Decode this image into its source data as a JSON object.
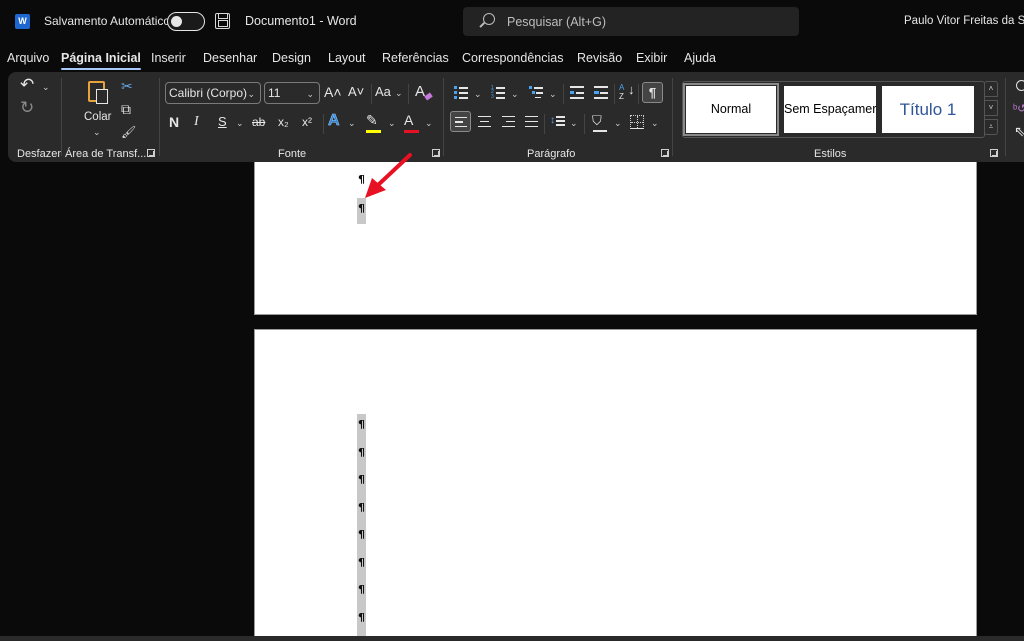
{
  "titlebar": {
    "app_icon": "word-logo-icon",
    "app_icon_letter": "W",
    "autosave_label": "Salvamento Automático",
    "autosave_on": false,
    "save_icon": "save-icon",
    "doc_title": "Documento1  -  Word",
    "search_placeholder": "Pesquisar (Alt+G)",
    "user_name": "Paulo Vitor Freitas da Silv"
  },
  "tabs": [
    {
      "label": "Arquivo",
      "active": false
    },
    {
      "label": "Página Inicial",
      "active": true
    },
    {
      "label": "Inserir",
      "active": false
    },
    {
      "label": "Desenhar",
      "active": false
    },
    {
      "label": "Design",
      "active": false
    },
    {
      "label": "Layout",
      "active": false
    },
    {
      "label": "Referências",
      "active": false
    },
    {
      "label": "Correspondências",
      "active": false
    },
    {
      "label": "Revisão",
      "active": false
    },
    {
      "label": "Exibir",
      "active": false
    },
    {
      "label": "Ajuda",
      "active": false
    }
  ],
  "ribbon": {
    "undo_group": {
      "label": "Desfazer",
      "undo_icon": "↶",
      "redo_icon": "↻"
    },
    "clipboard_group": {
      "label": "Área de Transf...",
      "paste_label": "Colar",
      "cut_icon": "✂",
      "copy_icon": "⧉",
      "format_painter_icon": "🖌"
    },
    "font_group": {
      "label": "Fonte",
      "font_name": "Calibri (Corpo)",
      "font_size": "11",
      "grow": "A˄",
      "shrink": "A˅",
      "change_case": "Aa",
      "clear_format": "A",
      "bold": "N",
      "italic": "I",
      "underline": "S",
      "strikethrough": "ab",
      "subscript": "x₂",
      "superscript": "x²",
      "text_effects": "A",
      "highlight": "✎",
      "font_color": "A",
      "highlight_color": "#ffff00",
      "font_color_value": "#e81123"
    },
    "paragraph_group": {
      "label": "Parágrafo",
      "show_marks_icon": "¶",
      "show_marks_active": true,
      "align_left_active": true,
      "sort_icon": "A↓Z"
    },
    "styles_group": {
      "label": "Estilos",
      "styles": [
        {
          "label": "Normal",
          "selected": true
        },
        {
          "label": "Sem Espaçamer",
          "selected": false
        },
        {
          "label": "Título 1",
          "selected": false
        }
      ]
    }
  },
  "document": {
    "paragraph_mark": "¶",
    "page1_marks": 2,
    "page2_marks": 8,
    "annotation": "red-arrow"
  }
}
